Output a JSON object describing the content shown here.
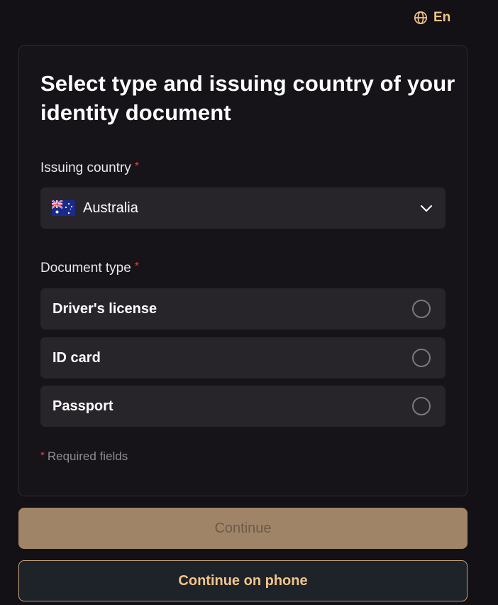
{
  "language": {
    "label": "En",
    "icon": "globe-icon"
  },
  "form": {
    "title": "Select type and issuing country of your identity document",
    "required_marker": "*",
    "country": {
      "label": "Issuing country",
      "selected": "Australia",
      "flag_icon": "australia-flag-icon"
    },
    "document_type": {
      "label": "Document type",
      "options": [
        {
          "label": "Driver's license",
          "selected": false
        },
        {
          "label": "ID card",
          "selected": false
        },
        {
          "label": "Passport",
          "selected": false
        }
      ]
    },
    "required_note": "Required fields"
  },
  "buttons": {
    "continue": "Continue",
    "continue_on_phone": "Continue on phone"
  },
  "colors": {
    "background": "#131115",
    "accent": "#f2c58a",
    "required": "#e8403c",
    "continue_disabled_bg": "#a08467"
  }
}
